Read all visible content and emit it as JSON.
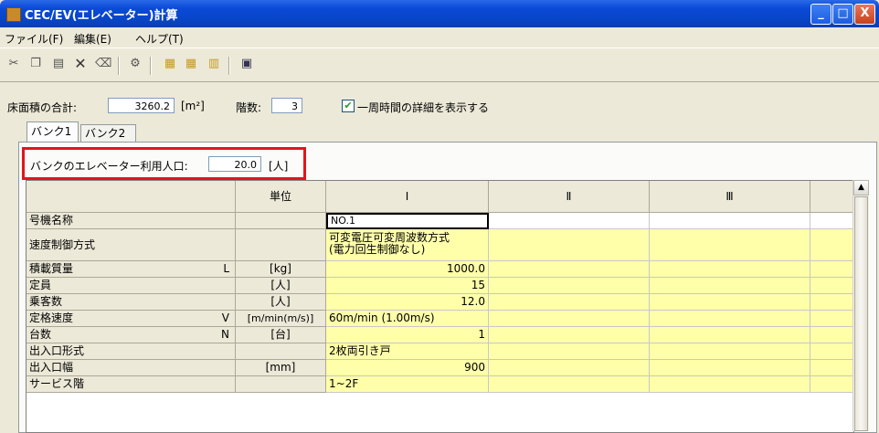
{
  "window": {
    "title": "CEC/EV(エレベーター)計算",
    "min": "_",
    "max": "□",
    "close": "X"
  },
  "menu": [
    "ファイル(F)",
    "編集(E)",
    "ヘルプ(T)"
  ],
  "toolbar_icons": [
    "cut-icon",
    "copy-icon",
    "paste-icon",
    "delete-icon",
    "backspace-icon",
    "settings-icon",
    "add-column-icon",
    "insert-column-icon",
    "remove-column-icon",
    "calculator-icon"
  ],
  "floor_area": {
    "label": "床面積の合計:",
    "value": "3260.2",
    "unit": "[m²]"
  },
  "floors": {
    "label": "階数:",
    "value": "3"
  },
  "detail_checkbox": {
    "label": "一周時間の詳細を表示する",
    "checked": true,
    "mark": "✔"
  },
  "tabs": [
    "バンク1",
    "バンク2"
  ],
  "bank_population": {
    "label": "バンクのエレベーター利用人口:",
    "value": "20.0",
    "unit": "[人]"
  },
  "grid": {
    "headers": [
      "",
      "単位",
      "Ⅰ",
      "Ⅱ",
      "Ⅲ"
    ],
    "rows": [
      {
        "name": "号機名称",
        "sym": "",
        "unit": "",
        "v1": "NO.1"
      },
      {
        "name": "速度制御方式",
        "sym": "",
        "unit": "",
        "v1": "可変電圧可変周波数方式",
        "v1b": "(電力回生制御なし)"
      },
      {
        "name": "積載質量",
        "sym": "L",
        "unit": "[kg]",
        "v1": "1000.0"
      },
      {
        "name": "定員",
        "sym": "",
        "unit": "[人]",
        "v1": "15"
      },
      {
        "name": "乗客数",
        "sym": "",
        "unit": "[人]",
        "v1": "12.0"
      },
      {
        "name": "定格速度",
        "sym": "V",
        "unit": "[m/min(m/s)]",
        "v1": "60m/min (1.00m/s)"
      },
      {
        "name": "台数",
        "sym": "N",
        "unit": "[台]",
        "v1": "1"
      },
      {
        "name": "出入口形式",
        "sym": "",
        "unit": "",
        "v1": "2枚両引き戸"
      },
      {
        "name": "出入口幅",
        "sym": "",
        "unit": "[mm]",
        "v1": "900"
      },
      {
        "name": "サービス階",
        "sym": "",
        "unit": "",
        "v1": "1~2F"
      }
    ]
  },
  "scroll_up": "▲",
  "colors": {
    "title_bar": "#0a4ad8",
    "highlight_box": "#e0161c",
    "input_cell": "#ffffaa"
  }
}
